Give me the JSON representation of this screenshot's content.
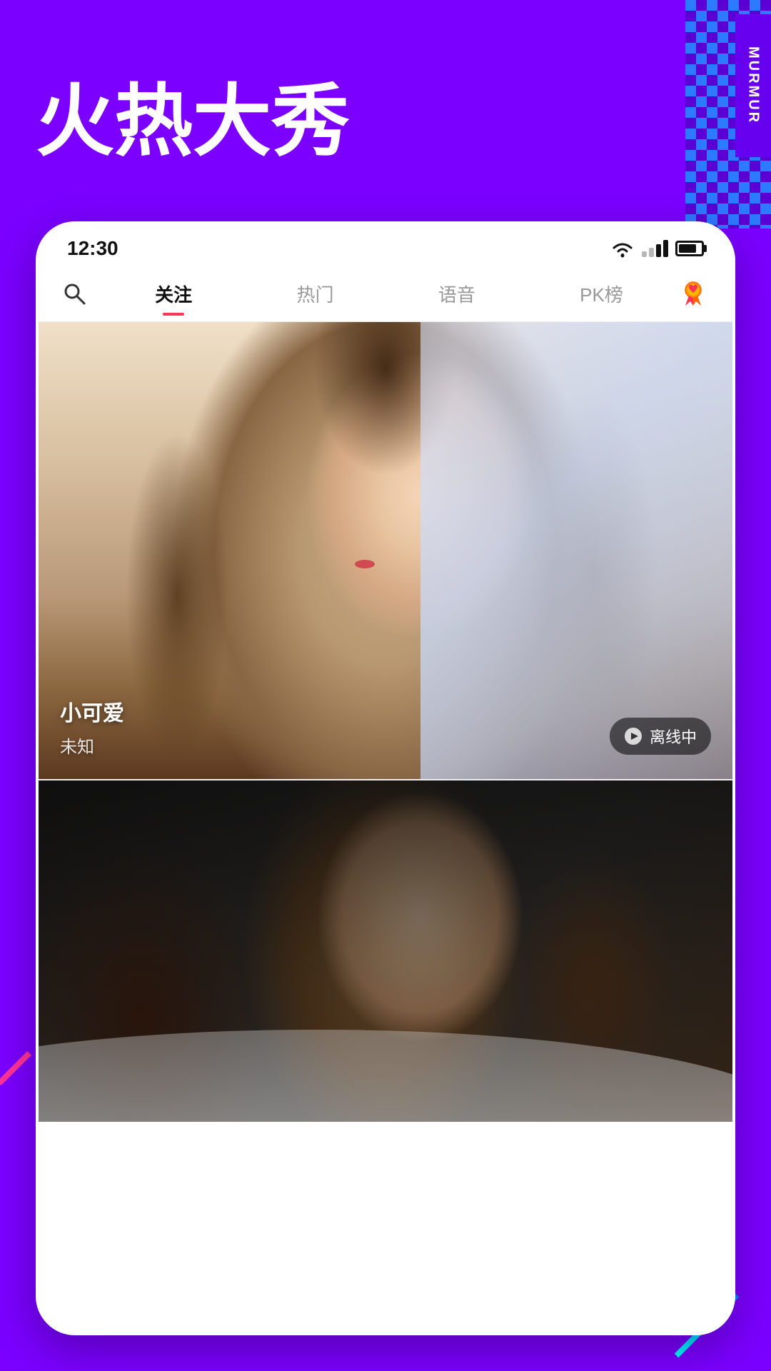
{
  "background": {
    "color": "#7B00FF",
    "title": "火热大秀"
  },
  "murmur": {
    "label": "MURMUR"
  },
  "status_bar": {
    "time": "12:30",
    "wifi": "wifi",
    "signal": "signal",
    "battery": "battery"
  },
  "nav": {
    "search_label": "search",
    "tabs": [
      {
        "label": "关注",
        "active": true
      },
      {
        "label": "热门",
        "active": false
      },
      {
        "label": "语音",
        "active": false
      },
      {
        "label": "PK榜",
        "active": false
      }
    ],
    "award_label": "award"
  },
  "videos": [
    {
      "id": "video-1",
      "streamer_name": "小可爱",
      "sub_label": "未知",
      "status": "offline",
      "status_label": "离线中",
      "status_icon": "play-circle"
    },
    {
      "id": "video-2",
      "streamer_name": "",
      "sub_label": "",
      "status": "online",
      "status_label": "",
      "status_icon": ""
    }
  ]
}
